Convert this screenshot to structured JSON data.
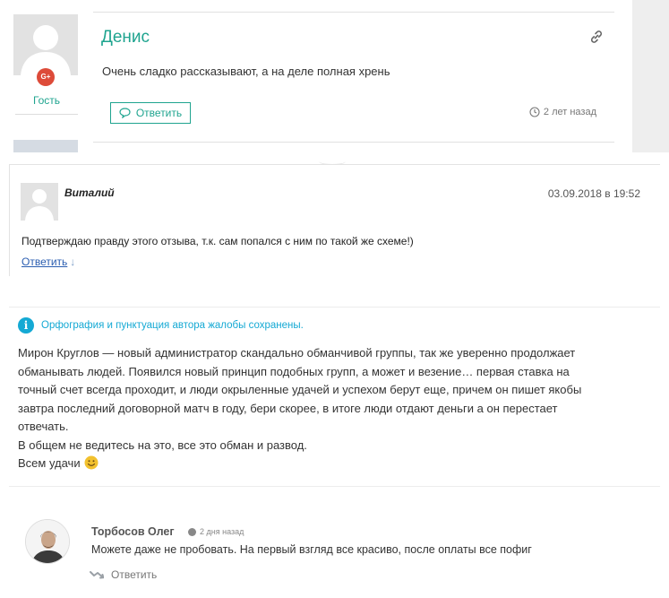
{
  "review1": {
    "author": "Денис",
    "role": "Гость",
    "social_badge": "G+",
    "text": "Очень сладко рассказывают, а на деле полная хрень",
    "reply_label": "Ответить",
    "time": "2 лет назад",
    "accent_color": "#1fa48f"
  },
  "review2": {
    "author": "Виталий",
    "date": "03.09.2018 в 19:52",
    "text": "Подтверждаю правду этого отзыва, т.к. сам попался с ним по такой же схеме!)",
    "reply_label": "Ответить",
    "reply_arrow": "↓",
    "link_color": "#2a5db0"
  },
  "complaint": {
    "notice_icon": "i",
    "notice": "Орфография и пунктуация автора жалобы сохранены.",
    "lines": [
      "Мирон Круглов — новый администратор скандально обманчивой группы, так же уверенно продолжает",
      "обманывать людей. Появился новый принцип подобных групп, а может и везение… первая ставка на",
      "точный счет всегда проходит, и люди окрыленные удачей и успехом берут еще, причем он пишет якобы",
      "завтра последний договорной матч в году, бери скорее, в итоге люди отдают деньги а он перестает",
      "отвечать.",
      "В общем не ведитесь на это, все это обман и развод."
    ],
    "last_line": "Всем удачи",
    "notice_color": "#14a9d4"
  },
  "review3": {
    "author": "Торбосов Олег",
    "time": "2 дня назад",
    "text": "Можете даже не пробовать. На первый взгляд все красиво, после оплаты все пофиг",
    "reply_label": "Ответить"
  },
  "icons": [
    "link-icon",
    "comment-icon",
    "clock-icon",
    "info-icon",
    "smile-emoji",
    "reply-arrow-icon"
  ]
}
